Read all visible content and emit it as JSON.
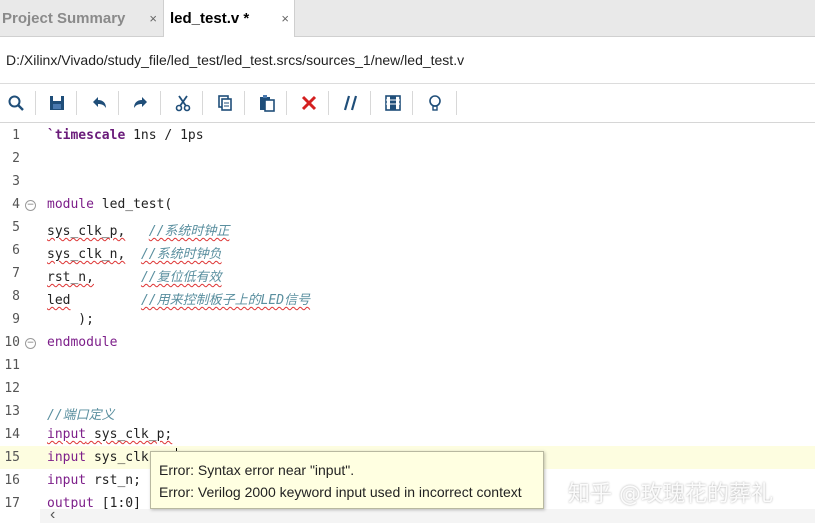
{
  "tabs": [
    {
      "label": "Project Summary",
      "close": "×"
    },
    {
      "label": "led_test.v *",
      "close": "×"
    }
  ],
  "path": "D:/Xilinx/Vivado/study_file/led_test/led_test.srcs/sources_1/new/led_test.v",
  "toolbar": {
    "icons": [
      "search-icon",
      "save-icon",
      "undo-icon",
      "redo-icon",
      "cut-icon",
      "copy-icon",
      "paste-icon",
      "delete-icon",
      "comment-icon",
      "columns-icon",
      "bulb-icon"
    ]
  },
  "editor": {
    "lines": [
      {
        "n": "1",
        "text": "`timescale 1ns / 1ps"
      },
      {
        "n": "2",
        "text": ""
      },
      {
        "n": "3",
        "text": ""
      },
      {
        "n": "4",
        "text": "module led_test("
      },
      {
        "n": "5",
        "text": "sys_clk_p,   //系统时钟正"
      },
      {
        "n": "6",
        "text": "sys_clk_n,  //系统时钟负"
      },
      {
        "n": "7",
        "text": "rst_n,      //复位低有效"
      },
      {
        "n": "8",
        "text": "led         //用来控制板子上的LED信号"
      },
      {
        "n": "9",
        "text": "    );"
      },
      {
        "n": "10",
        "text": "endmodule"
      },
      {
        "n": "11",
        "text": ""
      },
      {
        "n": "12",
        "text": ""
      },
      {
        "n": "13",
        "text": "//端口定义"
      },
      {
        "n": "14",
        "text": "input sys_clk_p;"
      },
      {
        "n": "15",
        "text": "input sys_clk"
      },
      {
        "n": "16",
        "text": "input rst_n;"
      },
      {
        "n": "17",
        "text": "output [1:0]"
      }
    ],
    "parts": {
      "l1_kw": "`timescale",
      "l1_rest": " 1ns / 1ps",
      "l4_kw": "module",
      "l4_rest": " led_test(",
      "l5_sig": "sys_clk_p,",
      "l5_cm": "//系统时钟正",
      "l6_sig": "sys_clk_n,",
      "l6_cm": "//系统时钟负",
      "l7_sig": "rst_n,",
      "l7_cm": "//复位低有效",
      "l8_sig": "led",
      "l8_cm": "//用来控制板子上的LED信号",
      "l9": "    );",
      "l10_kw": "endmodule",
      "l13_cm": "//端口定义",
      "l14_kw": "input",
      "l14_rest": " sys_clk_p;",
      "l15_kw": "input",
      "l15_rest": " sys_clk",
      "l16_kw": "input",
      "l16_rest": " rst_n;",
      "l17_kw": "output",
      "l17_rest": " [1:0]"
    }
  },
  "tooltip": {
    "line1": "Error: Syntax error near \"input\".",
    "line2": "Error: Verilog 2000 keyword input used in incorrect context"
  },
  "watermark": "知乎 @玫瑰花的葬礼",
  "hscroll": {
    "left_arrow": "‹"
  },
  "colors": {
    "keyword": "#7d1f8a",
    "comment": "#5a8f9f",
    "error": "#d33333",
    "tooltip_bg": "#ffffe1",
    "highlight_line": "#fdfde0"
  }
}
